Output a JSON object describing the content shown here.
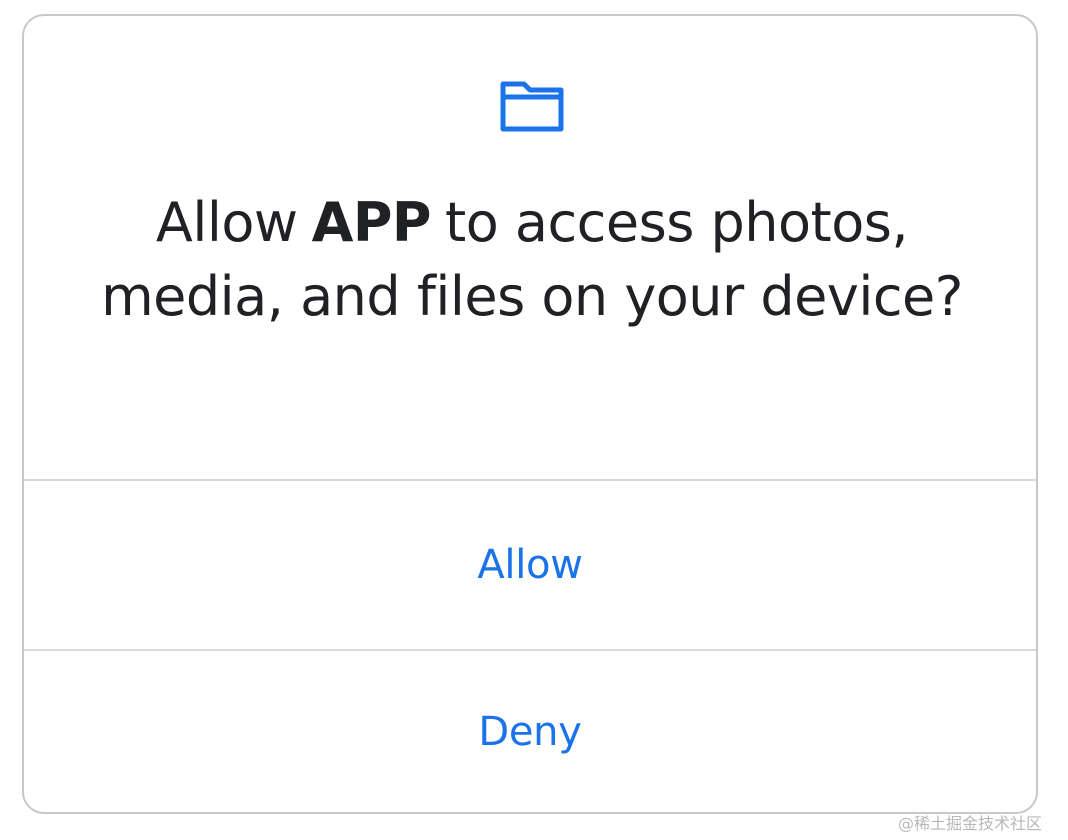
{
  "dialog": {
    "icon": "folder-icon",
    "title_before": "Allow",
    "app_name": "APP",
    "title_after": "to access photos, media, and files on your device?",
    "allow_label": "Allow",
    "deny_label": "Deny"
  },
  "watermark": "@稀土掘金技术社区",
  "colors": {
    "accent": "#1a73e8",
    "text": "#202124",
    "divider": "#d9d9d9",
    "border": "#c8c8c8"
  }
}
